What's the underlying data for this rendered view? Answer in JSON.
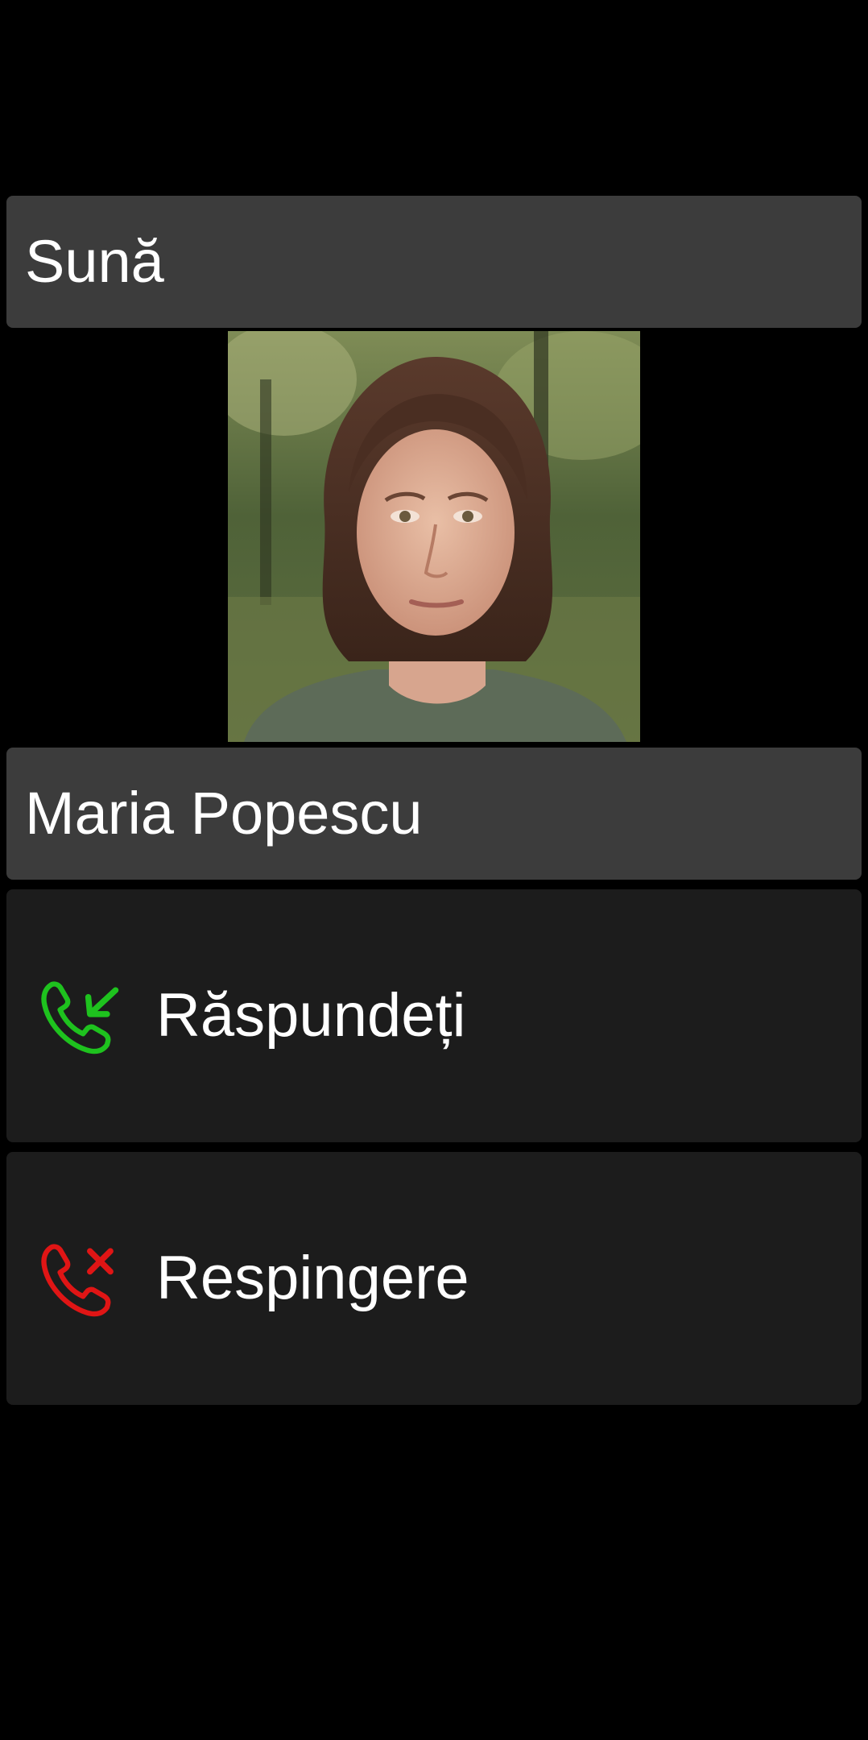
{
  "call": {
    "status_label": "Sună",
    "caller_name": "Maria Popescu"
  },
  "actions": {
    "answer": {
      "label": "Răspundeți",
      "icon": "incoming-call-icon",
      "color": "#1ec21e"
    },
    "reject": {
      "label": "Respingere",
      "icon": "call-reject-icon",
      "color": "#e01515"
    }
  },
  "colors": {
    "background": "#000000",
    "header_bar": "#3c3c3c",
    "action_button": "#1c1c1c",
    "text": "#ffffff"
  }
}
